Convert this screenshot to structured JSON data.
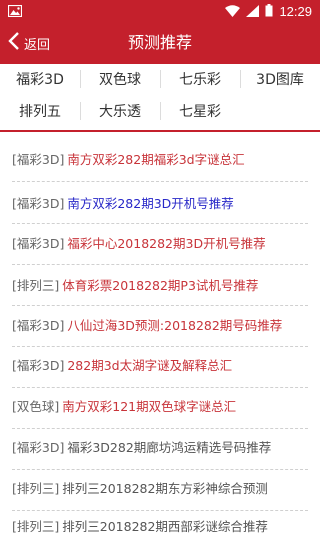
{
  "status_bar": {
    "time": "12:29"
  },
  "nav": {
    "back_label": "返回",
    "title": "预测推荐"
  },
  "tabs": [
    {
      "label": "福彩3D"
    },
    {
      "label": "双色球"
    },
    {
      "label": "七乐彩"
    },
    {
      "label": "3D图库"
    },
    {
      "label": "排列五"
    },
    {
      "label": "大乐透"
    },
    {
      "label": "七星彩"
    }
  ],
  "articles": [
    {
      "tag": "[福彩3D]",
      "title": "南方双彩282期福彩3d字谜总汇",
      "color": "#c8343a"
    },
    {
      "tag": "[福彩3D]",
      "title": "南方双彩282期3D开机号推荐",
      "color": "#2828c8"
    },
    {
      "tag": "[福彩3D]",
      "title": "福彩中心2018282期3D开机号推荐",
      "color": "#c8343a"
    },
    {
      "tag": "[排列三]",
      "title": "体育彩票2018282期P3试机号推荐",
      "color": "#c8343a"
    },
    {
      "tag": "[福彩3D]",
      "title": "八仙过海3D预测:2018282期号码推荐",
      "color": "#c8343a"
    },
    {
      "tag": "[福彩3D]",
      "title": "282期3d太湖字谜及解释总汇",
      "color": "#c8343a"
    },
    {
      "tag": "[双色球]",
      "title": "南方双彩121期双色球字谜总汇",
      "color": "#c8343a"
    },
    {
      "tag": "[福彩3D]",
      "title": "福彩3D282期廊坊鸿运精选号码推荐",
      "color": "#555555"
    },
    {
      "tag": "[排列三]",
      "title": "排列三2018282期东方彩神综合预测",
      "color": "#555555"
    },
    {
      "tag": "[排列三]",
      "title": "排列三2018282期西部彩谜综合推荐",
      "color": "#555555"
    }
  ]
}
